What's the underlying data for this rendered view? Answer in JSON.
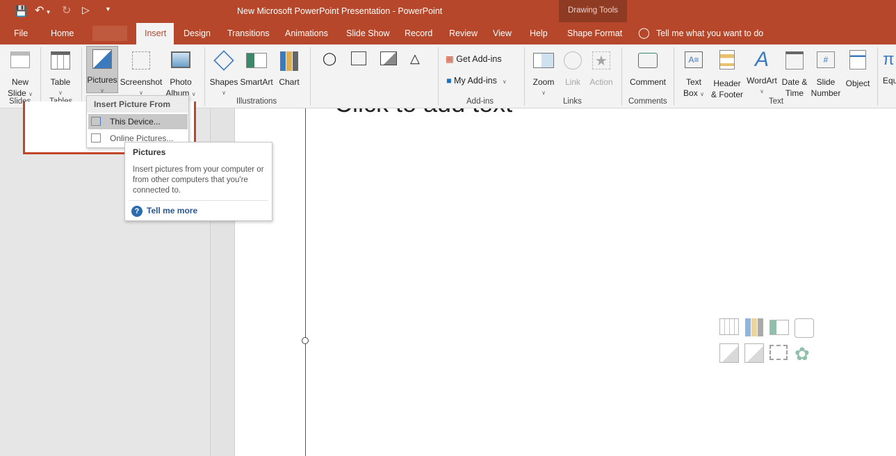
{
  "title": {
    "text": "New Microsoft PowerPoint Presentation  -  PowerPoint",
    "context": "Drawing Tools"
  },
  "qat": [
    "save-icon",
    "undo-icon",
    "redo-icon",
    "present-icon",
    "customize-icon"
  ],
  "tabs": [
    "File",
    "Home",
    "Insert",
    "Design",
    "Transitions",
    "Animations",
    "Slide Show",
    "Record",
    "Review",
    "View",
    "Help",
    "Shape Format"
  ],
  "active_tab": "Insert",
  "tellme": "Tell me what you want to do",
  "ribbon": {
    "new_slide": [
      "New",
      "Slide"
    ],
    "table": "Table",
    "pictures": "Pictures",
    "screenshot": "Screenshot",
    "photo_album": [
      "Photo",
      "Album"
    ],
    "shapes": "Shapes",
    "smartart": "SmartArt",
    "chart": "Chart",
    "get_addins": "Get Add-ins",
    "my_addins": "My Add-ins",
    "zoom": "Zoom",
    "link": "Link",
    "action": "Action",
    "comment": "Comment",
    "text_box": [
      "Text",
      "Box"
    ],
    "header_footer": [
      "Header",
      "& Footer"
    ],
    "wordart": "WordArt",
    "date_time": [
      "Date &",
      "Time"
    ],
    "slide_number": [
      "Slide",
      "Number"
    ],
    "object": "Object",
    "equation": "Equ",
    "groups": [
      "Slides",
      "Tables",
      "Illustrations",
      "Add-ins",
      "Links",
      "Comments",
      "Text"
    ]
  },
  "dropdown": {
    "header": "Insert Picture From",
    "items": [
      "This Device...",
      "Online Pictures..."
    ]
  },
  "tooltip": {
    "title": "Pictures",
    "body": "Insert pictures from your computer or from other computers that you're connected to.",
    "link": "Tell me more"
  },
  "slide": {
    "placeholder": "Click to add text"
  },
  "colors": {
    "accent": "#b7472a",
    "context_tab": "#8f3a23",
    "link": "#2b5797"
  }
}
